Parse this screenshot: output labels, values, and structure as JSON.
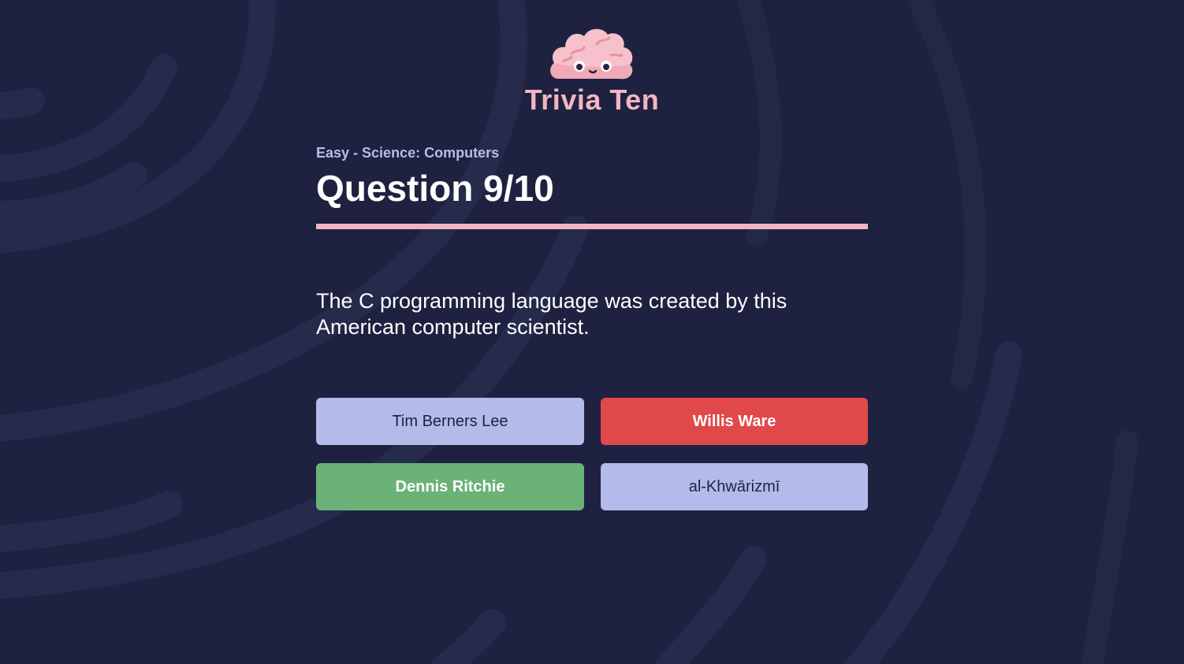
{
  "app": {
    "title": "Trivia Ten",
    "logo_icon": "brain-mascot-icon"
  },
  "quiz": {
    "category": "Easy - Science: Computers",
    "heading": "Question 9/10",
    "current": 9,
    "total": 10,
    "progress_fraction": 1.0,
    "question": "The C programming language was created by this American computer scientist.",
    "answers": [
      {
        "label": "Tim Berners Lee",
        "state": "neutral"
      },
      {
        "label": "Willis Ware",
        "state": "wrong"
      },
      {
        "label": "Dennis Ritchie",
        "state": "correct"
      },
      {
        "label": "al-Khwārizmī",
        "state": "neutral"
      }
    ]
  },
  "colors": {
    "background": "#1e2240",
    "accent_pink": "#f2b6c0",
    "neutral_answer": "#b4bbea",
    "wrong_answer": "#e0484a",
    "correct_answer": "#6ab277"
  }
}
